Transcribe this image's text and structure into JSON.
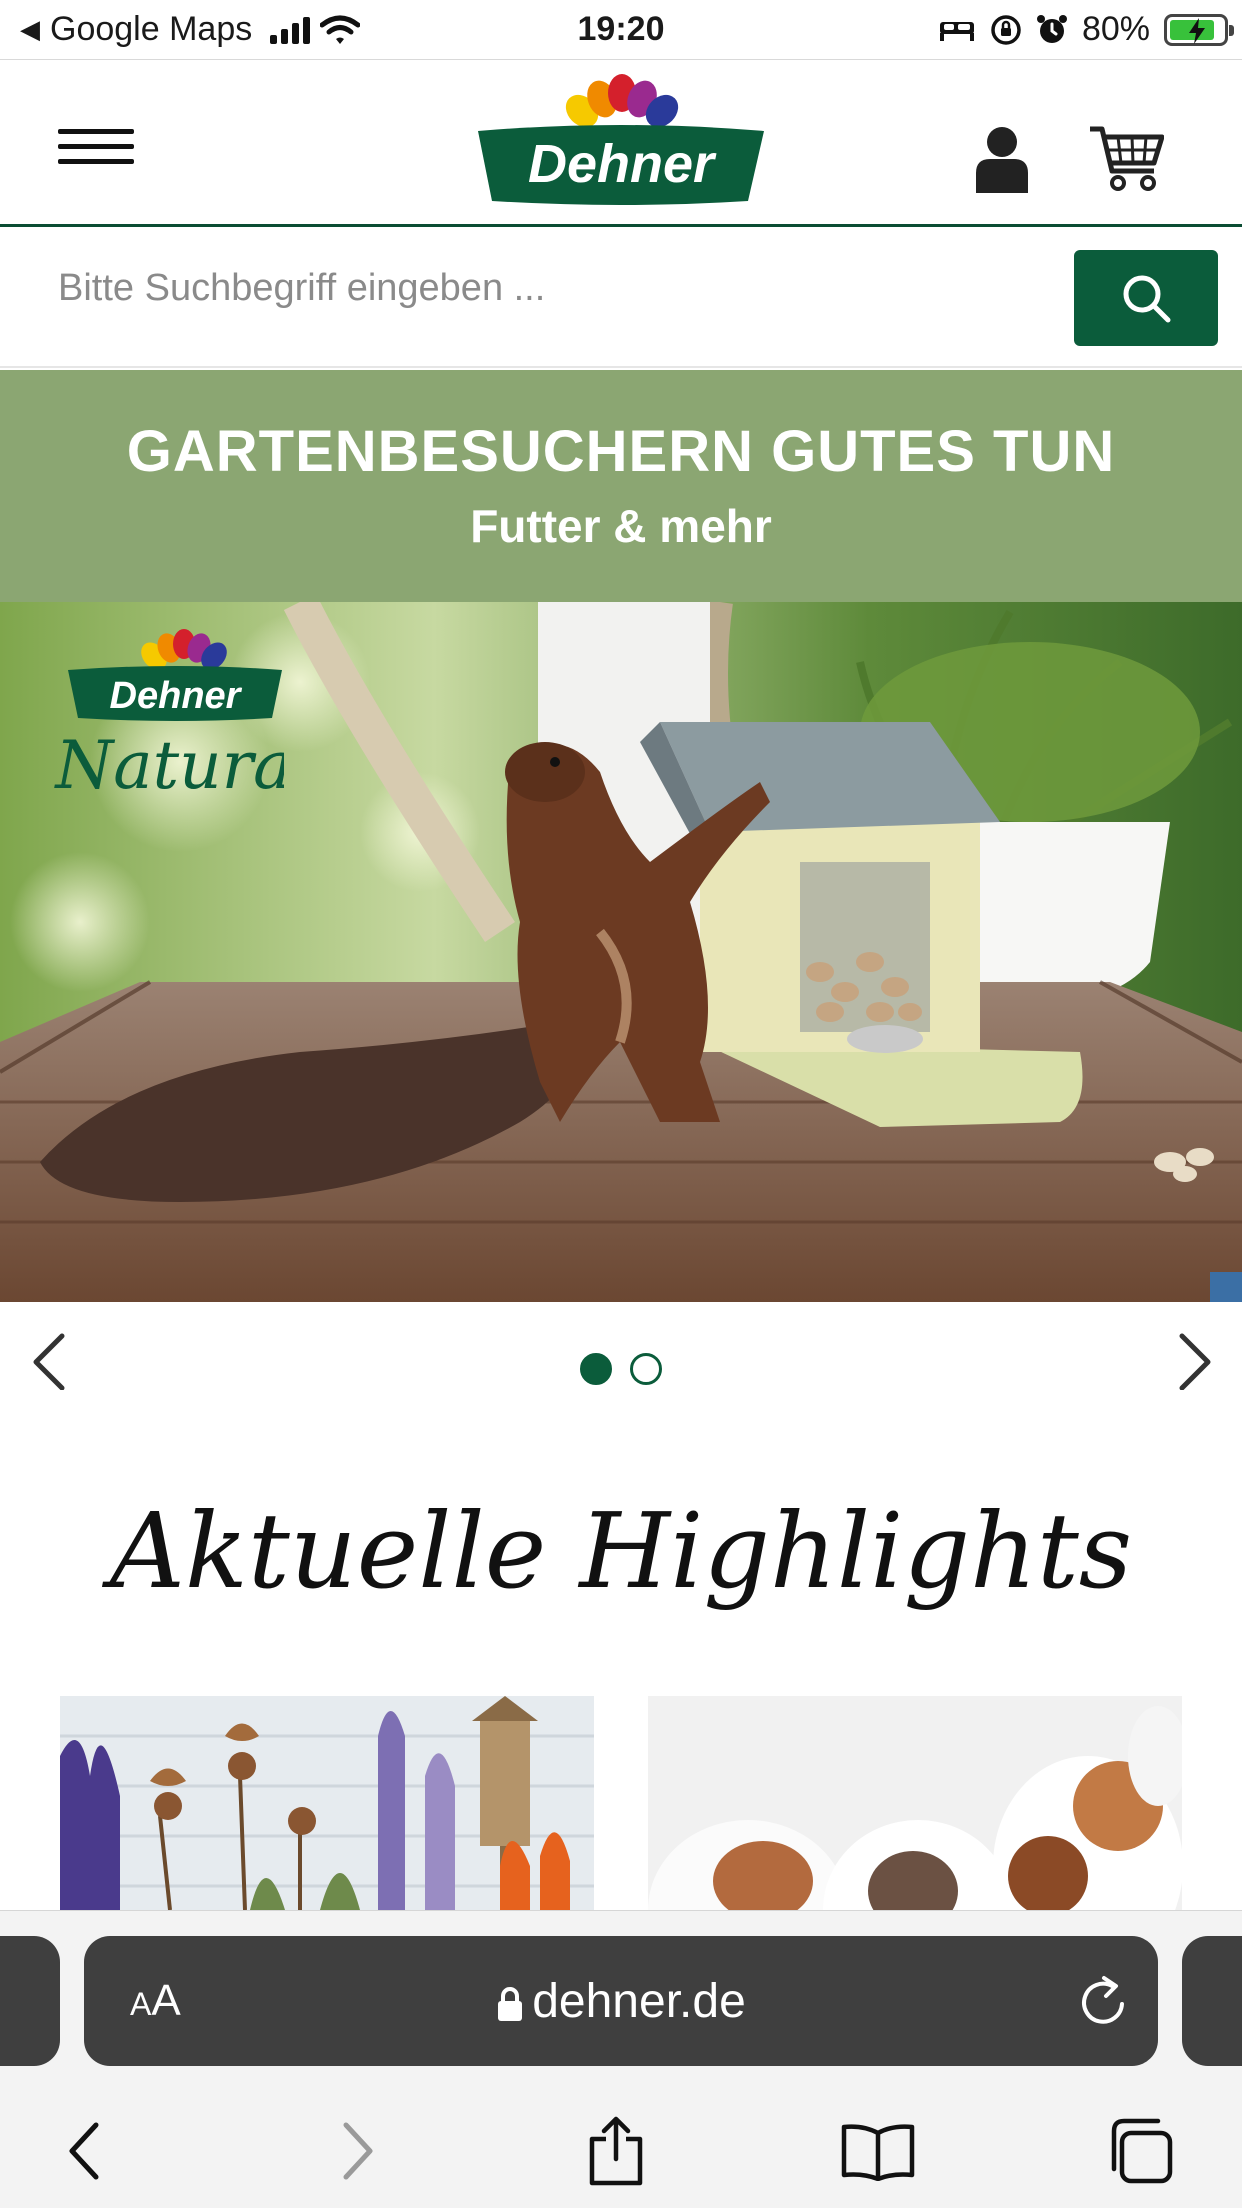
{
  "status_bar": {
    "back_app": "Google Maps",
    "time": "19:20",
    "battery": "80%",
    "battery_level": 0.8
  },
  "header": {
    "logo_text": "Dehner",
    "icons": [
      "menu-icon",
      "account-icon",
      "cart-icon"
    ]
  },
  "search": {
    "placeholder": "Bitte Suchbegriff eingeben ...",
    "button_icon": "search-icon"
  },
  "promo": {
    "title": "GARTENBESUCHERN GUTES TUN",
    "subtitle": "Futter & mehr"
  },
  "hero": {
    "brand_logo_top": "Dehner",
    "brand_logo_bottom": "Natura"
  },
  "carousel": {
    "slide_count": 2,
    "active_index": 0
  },
  "highlights": {
    "title": "Aktuelle Highlights"
  },
  "browser": {
    "aa_small": "A",
    "aa_large": "A",
    "url": "dehner.de"
  },
  "colors": {
    "brand_green": "#0b5c3b",
    "promo_green": "#8ba672",
    "header_rule": "#0b4d33"
  }
}
